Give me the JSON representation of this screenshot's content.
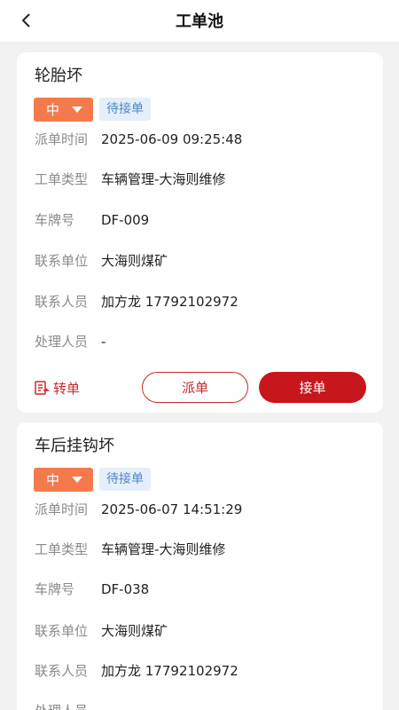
{
  "header": {
    "title": "工单池",
    "back_icon": "chevron-left-icon"
  },
  "labels": {
    "dispatch_time": "派单时间",
    "order_type": "工单类型",
    "plate": "车牌号",
    "contact_unit": "联系单位",
    "contact_person": "联系人员",
    "handler": "处理人员"
  },
  "actions": {
    "transfer": "转单",
    "dispatch": "派单",
    "accept": "接单"
  },
  "colors": {
    "accent_red": "#c8282b",
    "priority_orange": "#f47a4b",
    "status_blue": "#4f86c6"
  },
  "orders": [
    {
      "title": "轮胎坏",
      "priority": "中",
      "status": "待接单",
      "dispatch_time": "2025-06-09 09:25:48",
      "order_type": "车辆管理-大海则维修",
      "plate": "DF-009",
      "contact_unit": "大海则煤矿",
      "contact_person": "加方龙 17792102972",
      "handler": "-"
    },
    {
      "title": "车后挂钩坏",
      "priority": "中",
      "status": "待接单",
      "dispatch_time": "2025-06-07 14:51:29",
      "order_type": "车辆管理-大海则维修",
      "plate": "DF-038",
      "contact_unit": "大海则煤矿",
      "contact_person": "加方龙 17792102972",
      "handler": ""
    }
  ]
}
